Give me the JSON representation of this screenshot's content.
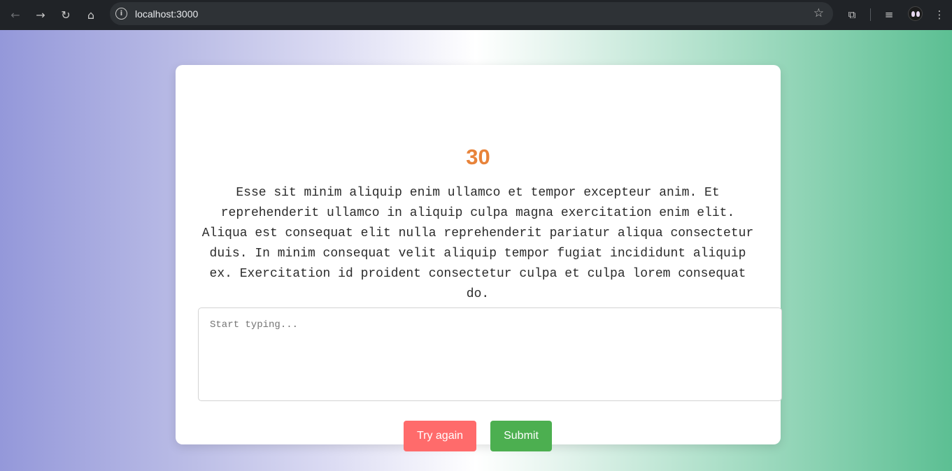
{
  "browser": {
    "url": "localhost:3000"
  },
  "game": {
    "timer": "30",
    "passage": "Esse sit minim aliquip enim ullamco et tempor excepteur anim. Et reprehenderit ullamco in aliquip culpa magna exercitation enim elit. Aliqua est consequat elit nulla reprehenderit pariatur aliqua consectetur duis. In minim consequat velit aliquip tempor fugiat incididunt aliquip ex. Exercitation id proident consectetur culpa et culpa lorem consequat do.",
    "input_placeholder": "Start typing...",
    "input_value": "",
    "retry_label": "Try again",
    "submit_label": "Submit"
  },
  "colors": {
    "timer": "#e8833a",
    "retry_button": "#ff6b6b",
    "submit_button": "#4caf50"
  }
}
